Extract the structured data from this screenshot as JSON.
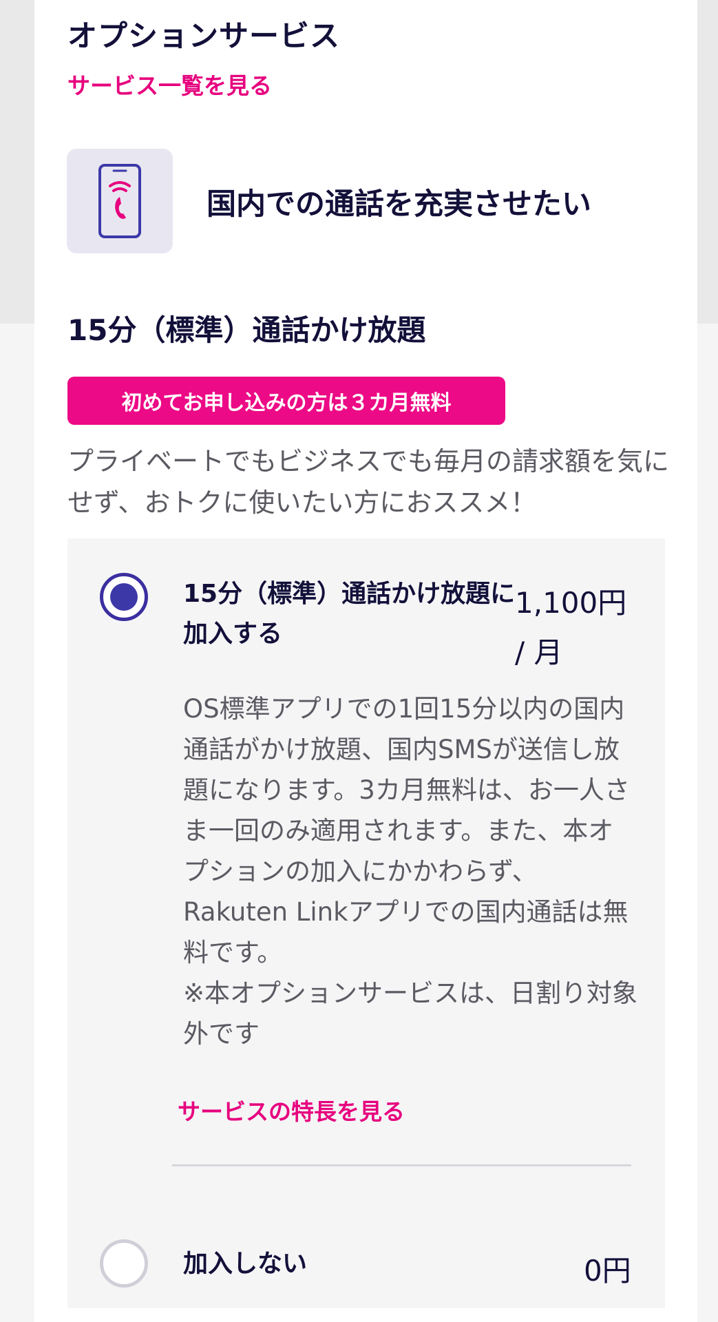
{
  "section": {
    "title": "オプションサービス",
    "service_list_link": "サービス一覧を見る"
  },
  "category": {
    "icon": "smartphone-call-icon",
    "title": "国内での通話を充実させたい"
  },
  "plan": {
    "title": "15分（標準）通話かけ放題",
    "promo_badge": "初めてお申し込みの方は３カ月無料",
    "description": "プライベートでもビジネスでも毎月の請求額を気にせず、おトクに使いたい方におススメ！"
  },
  "options": [
    {
      "label": "15分（標準）通話かけ放題に加入する",
      "price": "1,100円 / 月",
      "selected": true,
      "description": "OS標準アプリでの1回15分以内の国内通話がかけ放題、国内SMSが送信し放題になります。3カ月無料は、お一人さま一回のみ適用されます。また、本オプションの加入にかかわらず、Rakuten Linkアプリでの国内通話は無料です。\n※本オプションサービスは、日割り対象外です",
      "feature_link": "サービスの特長を見る"
    },
    {
      "label": "加入しない",
      "price": "0円",
      "selected": false
    }
  ],
  "colors": {
    "accent": "#e6007e",
    "primary": "#3d38a8",
    "text": "#13103a",
    "muted_text": "#5a5a62"
  }
}
